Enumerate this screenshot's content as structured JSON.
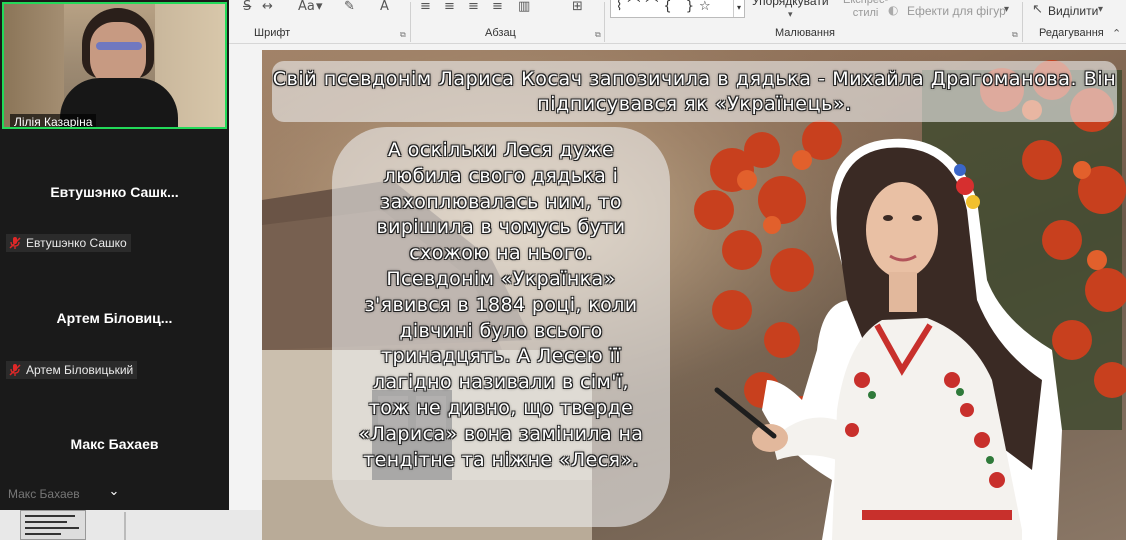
{
  "ribbon": {
    "groups": {
      "font": "Шрифт",
      "paragraph": "Абзац",
      "drawing": "Малювання",
      "editing": "Редагування"
    },
    "arrange_label": "Упорядкувати",
    "quick_styles_label": "Експрес-\nстилі",
    "shape_effects_label": "Ефекти для фігур",
    "select_label": "Виділити",
    "shape_glyphs": "⌇⌒⌒{ }☆"
  },
  "participants": [
    {
      "name": "Лілія Казаріна",
      "muted": false,
      "video": true
    },
    {
      "name": "Евтушэнко  Сашк...",
      "label": "Евтушэнко Сашко",
      "muted": true
    },
    {
      "name": "Артем Біловиц...",
      "label": "Артем Біловицький",
      "muted": true
    },
    {
      "name": "Макс Бахаев",
      "label": "Макс Бахаев",
      "muted": false
    }
  ],
  "slide": {
    "title": "Свій псевдонім Лариса Косач запозичила в дядька - Михайла Драгоманова. Він підписувався як «Українець».",
    "body": "А оскільки Леся дуже любила свого дядька і захоплювалась ним, то вирішила в чомусь бути схожою на нього. Псевдонім «Українка» з'явився в 1884 році, коли дівчині було всього тринадцять. А Лесею її лагідно називали в сім'ї, тож не дивно, що тверде «Лариса» вона замінила на тендітне та ніжне «Леся»."
  },
  "colors": {
    "active_speaker_border": "#23d959",
    "panel_bg": "#1a1a1a",
    "mute_icon": "#e02828",
    "ribbon_bg": "#f3f3f3"
  }
}
